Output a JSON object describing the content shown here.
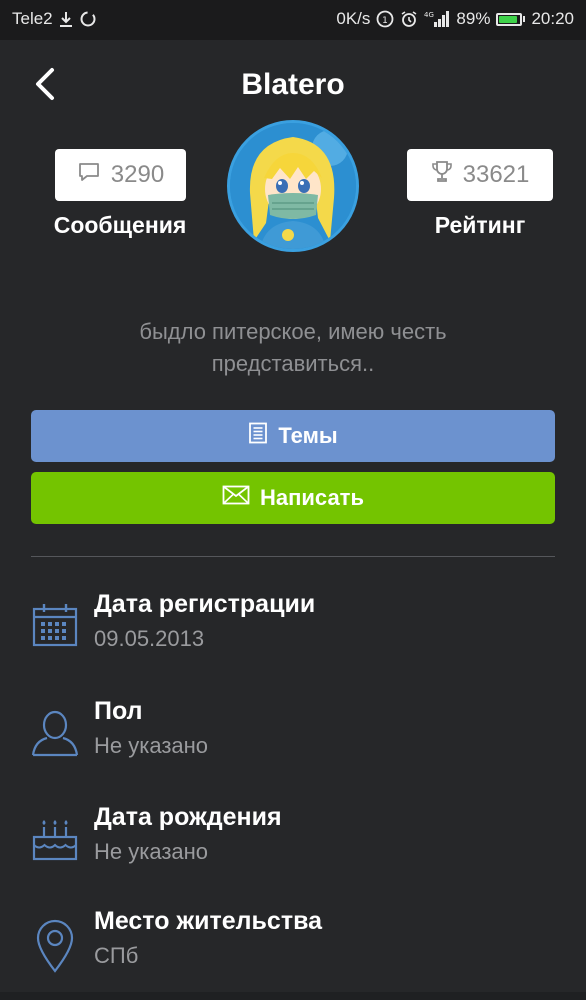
{
  "status_bar": {
    "carrier": "Tele2",
    "speed": "0K/s",
    "network": "4G",
    "battery_percent_text": "89%",
    "battery_level": 0.89,
    "time": "20:20"
  },
  "header": {
    "title": "Blatero"
  },
  "stats": {
    "messages_count": "3290",
    "messages_label": "Сообщения",
    "rating_count": "33621",
    "rating_label": "Рейтинг"
  },
  "bio": "быдло питерское, имею честь представиться..",
  "buttons": {
    "topics_label": "Темы",
    "write_label": "Написать"
  },
  "info": [
    {
      "title": "Дата регистрации",
      "value": "09.05.2013",
      "icon": "calendar-icon"
    },
    {
      "title": "Пол",
      "value": "Не указано",
      "icon": "user-icon"
    },
    {
      "title": "Дата рождения",
      "value": "Не указано",
      "icon": "cake-icon"
    },
    {
      "title": "Место жительства",
      "value": "СПб",
      "icon": "location-pin-icon"
    }
  ],
  "colors": {
    "background": "#262729",
    "topics_button": "#6c92cf",
    "write_button": "#74c400",
    "icon_accent": "#5b86c0"
  }
}
